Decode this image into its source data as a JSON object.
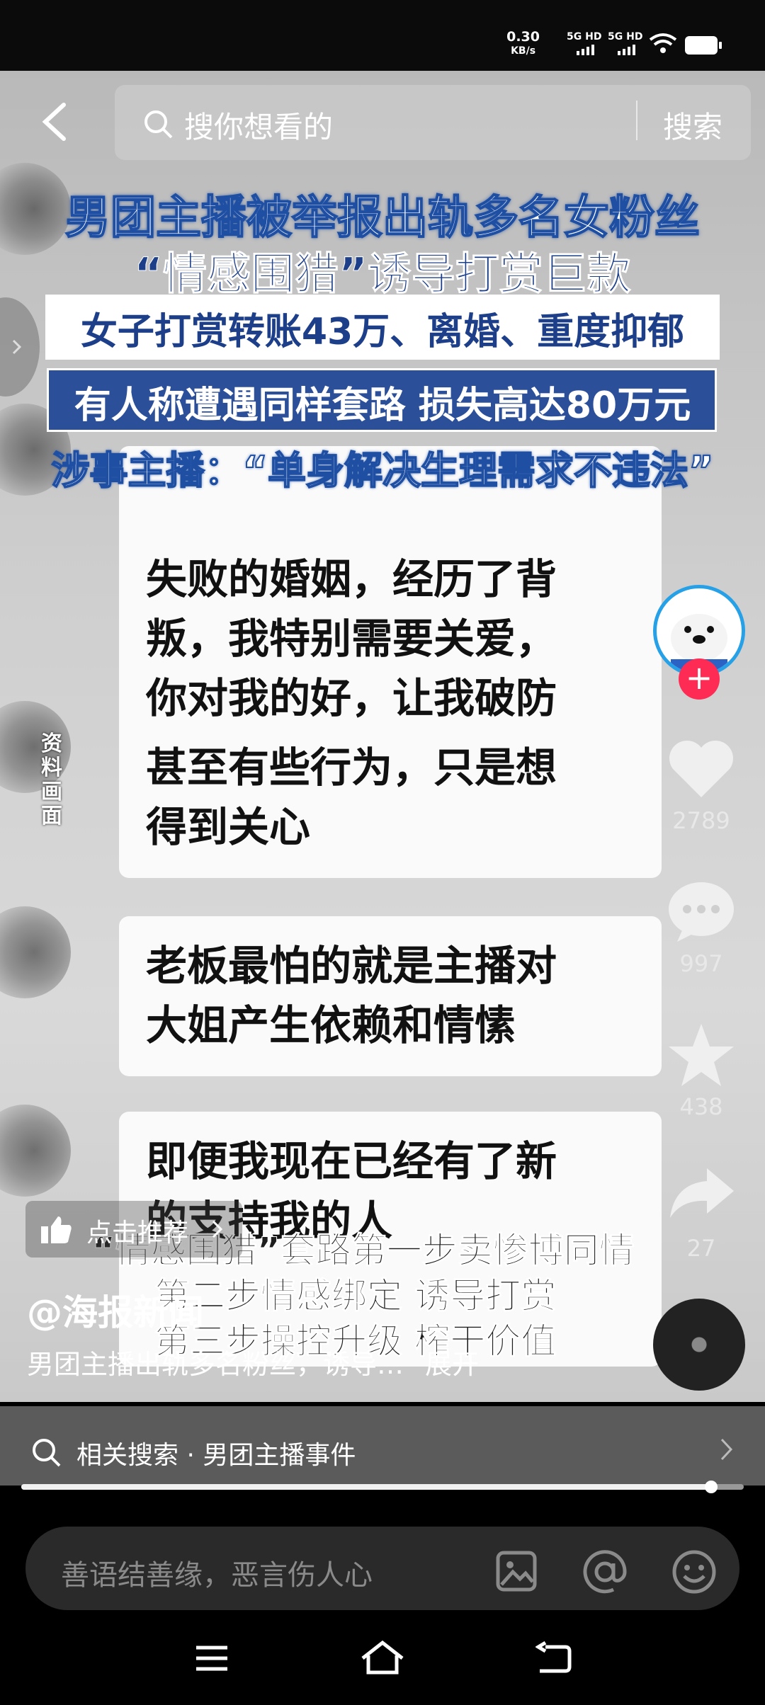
{
  "status_bar": {
    "net_speed": "0.30",
    "net_unit": "KB/s",
    "sim1": "5G HD",
    "sim2": "5G HD"
  },
  "top_bar": {
    "search_placeholder": "搜你想看的",
    "search_button": "搜索"
  },
  "video": {
    "headline": [
      "男团主播被举报出轨多名女粉丝",
      "“情感围猎”诱导打赏巨款",
      "女子打赏转账43万、离婚、重度抑郁",
      "有人称遭遇同样套路 损失高达80万元",
      "涉事主播：“单身解决生理需求不违法”"
    ],
    "bubbles": [
      "失败的婚姻，经历了背",
      "叛，我特别需要关爱，",
      "你对我的好，让我破防",
      "甚至有些行为，只是想",
      "得到关心",
      "老板最怕的就是主播对",
      "大姐产生依赖和情愫",
      "即便我现在已经有了新",
      "的支持我的人"
    ],
    "side_label": "资料画面",
    "subtitles": [
      "“情感围猎”套路第一步卖惨博同情",
      "第二步情感绑定 诱导打赏",
      "第三步操控升级 榨干价值"
    ]
  },
  "rail": {
    "like_count": "2789",
    "comment_count": "997",
    "favorite_count": "438",
    "share_count": "27"
  },
  "info": {
    "recommend_label": "点击推荐",
    "author": "@海报新闻",
    "description": "男团主播出轨多名粉丝，诱导…",
    "expand": "展开"
  },
  "related_search": {
    "label": "相关搜索 · 男团主播事件"
  },
  "playback": {
    "progress": 0.955
  },
  "comment": {
    "placeholder": "善语结善缘，恶言伤人心"
  },
  "colors": {
    "headline_blue": "#1d3f8a",
    "follow_red": "#fe2c55",
    "creator_ring": "#26a0e6"
  },
  "icons": [
    "back-icon",
    "search-icon",
    "thumbs-up-icon",
    "heart-icon",
    "comment-icon",
    "star-icon",
    "share-icon",
    "image-icon",
    "at-icon",
    "emoji-icon",
    "menu-icon",
    "home-icon",
    "back-nav-icon",
    "chevron-right-icon"
  ]
}
